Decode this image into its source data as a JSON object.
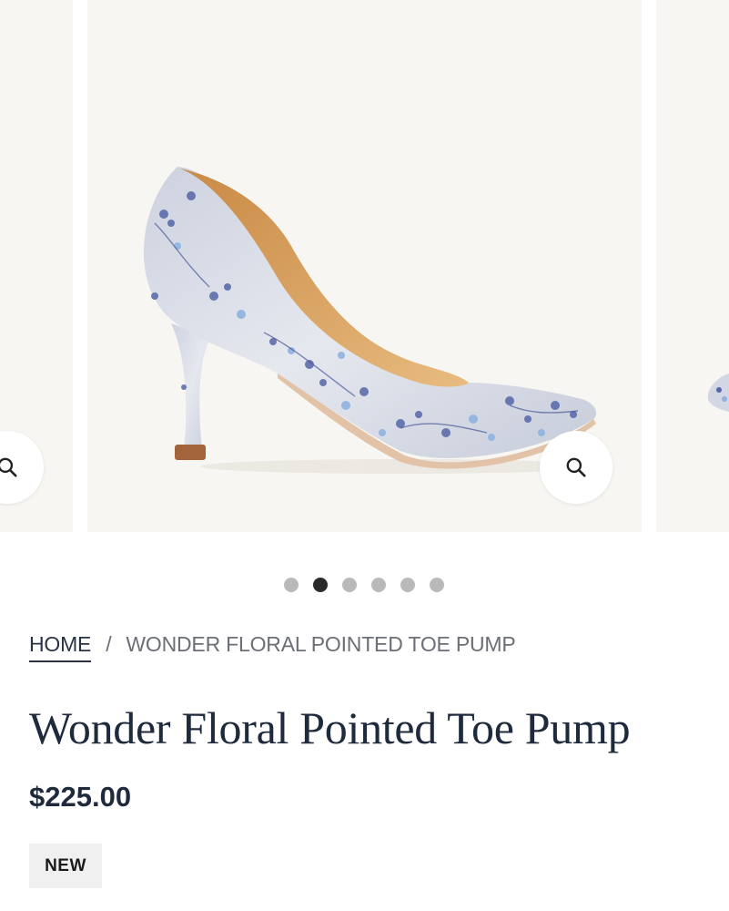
{
  "gallery": {
    "slide_count": 6,
    "active_index": 1,
    "zoom_icon": "search-icon",
    "product_image": "floral-pointed-toe-pump"
  },
  "breadcrumb": {
    "home": "HOME",
    "separator": "/",
    "current": "WONDER FLORAL POINTED TOE PUMP"
  },
  "product": {
    "title": "Wonder Floral Pointed Toe Pump",
    "price": "$225.00",
    "badge": "NEW"
  },
  "colors": {
    "slide_bg": "#f8f6f3",
    "text_primary": "#1f2a3c",
    "dot_active": "#2b2b2b",
    "dot_inactive": "#b9b9b9",
    "badge_bg": "#f0f0f0"
  }
}
